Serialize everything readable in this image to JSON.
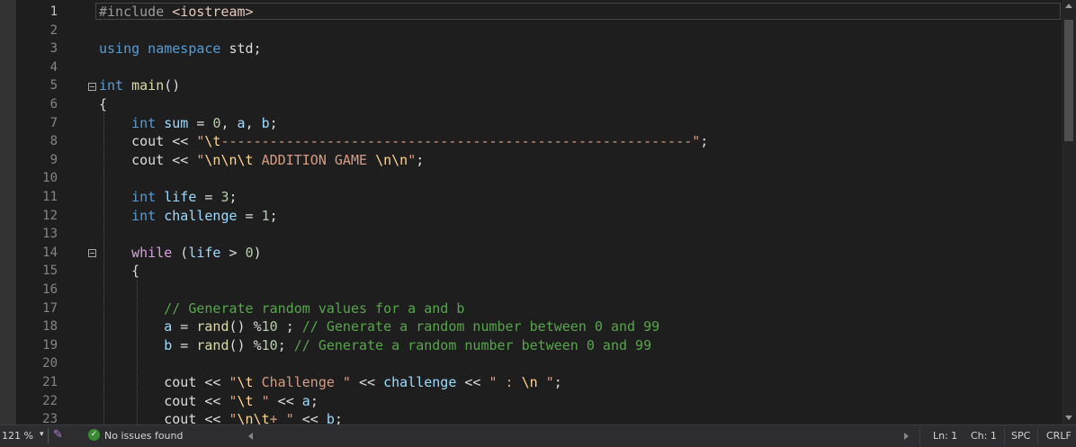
{
  "editor": {
    "lines": [
      {
        "n": "1",
        "tokens": [
          {
            "c": "pre",
            "t": "#include "
          },
          {
            "c": "inc",
            "t": "<iostream>"
          }
        ]
      },
      {
        "n": "2",
        "tokens": []
      },
      {
        "n": "3",
        "tokens": [
          {
            "c": "kw",
            "t": "using namespace "
          },
          {
            "c": "txt",
            "t": "std;"
          }
        ]
      },
      {
        "n": "4",
        "tokens": []
      },
      {
        "n": "5",
        "tokens": [
          {
            "c": "kw",
            "t": "int "
          },
          {
            "c": "fn",
            "t": "main"
          },
          {
            "c": "txt",
            "t": "()"
          }
        ]
      },
      {
        "n": "6",
        "tokens": [
          {
            "c": "txt",
            "t": "{"
          }
        ]
      },
      {
        "n": "7",
        "tokens": [
          {
            "c": "txt",
            "t": "    "
          },
          {
            "c": "kw",
            "t": "int "
          },
          {
            "c": "var",
            "t": "sum"
          },
          {
            "c": "txt",
            "t": " = "
          },
          {
            "c": "num",
            "t": "0"
          },
          {
            "c": "txt",
            "t": ", "
          },
          {
            "c": "var",
            "t": "a"
          },
          {
            "c": "txt",
            "t": ", "
          },
          {
            "c": "var",
            "t": "b"
          },
          {
            "c": "txt",
            "t": ";"
          }
        ]
      },
      {
        "n": "8",
        "tokens": [
          {
            "c": "txt",
            "t": "    cout << "
          },
          {
            "c": "str",
            "t": "\""
          },
          {
            "c": "esc",
            "t": "\\t"
          },
          {
            "c": "str",
            "t": "----------------------------------------------------------\""
          },
          {
            "c": "txt",
            "t": ";"
          }
        ]
      },
      {
        "n": "9",
        "tokens": [
          {
            "c": "txt",
            "t": "    cout << "
          },
          {
            "c": "str",
            "t": "\""
          },
          {
            "c": "esc",
            "t": "\\n\\n\\t"
          },
          {
            "c": "str",
            "t": " ADDITION GAME "
          },
          {
            "c": "esc",
            "t": "\\n\\n"
          },
          {
            "c": "str",
            "t": "\""
          },
          {
            "c": "txt",
            "t": ";"
          }
        ]
      },
      {
        "n": "10",
        "tokens": []
      },
      {
        "n": "11",
        "tokens": [
          {
            "c": "txt",
            "t": "    "
          },
          {
            "c": "kw",
            "t": "int "
          },
          {
            "c": "var",
            "t": "life"
          },
          {
            "c": "txt",
            "t": " = "
          },
          {
            "c": "num",
            "t": "3"
          },
          {
            "c": "txt",
            "t": ";"
          }
        ]
      },
      {
        "n": "12",
        "tokens": [
          {
            "c": "txt",
            "t": "    "
          },
          {
            "c": "kw",
            "t": "int "
          },
          {
            "c": "var",
            "t": "challenge"
          },
          {
            "c": "txt",
            "t": " = "
          },
          {
            "c": "num",
            "t": "1"
          },
          {
            "c": "txt",
            "t": ";"
          }
        ]
      },
      {
        "n": "13",
        "tokens": []
      },
      {
        "n": "14",
        "tokens": [
          {
            "c": "txt",
            "t": "    "
          },
          {
            "c": "ctl",
            "t": "while"
          },
          {
            "c": "txt",
            "t": " ("
          },
          {
            "c": "var",
            "t": "life"
          },
          {
            "c": "txt",
            "t": " > "
          },
          {
            "c": "num",
            "t": "0"
          },
          {
            "c": "txt",
            "t": ")"
          }
        ]
      },
      {
        "n": "15",
        "tokens": [
          {
            "c": "txt",
            "t": "    {"
          }
        ]
      },
      {
        "n": "16",
        "tokens": []
      },
      {
        "n": "17",
        "tokens": [
          {
            "c": "txt",
            "t": "        "
          },
          {
            "c": "cmt",
            "t": "// Generate random values for a and b"
          }
        ]
      },
      {
        "n": "18",
        "tokens": [
          {
            "c": "txt",
            "t": "        "
          },
          {
            "c": "var",
            "t": "a"
          },
          {
            "c": "txt",
            "t": " = "
          },
          {
            "c": "fn",
            "t": "rand"
          },
          {
            "c": "txt",
            "t": "() %"
          },
          {
            "c": "num",
            "t": "10"
          },
          {
            "c": "txt",
            "t": " ; "
          },
          {
            "c": "cmt",
            "t": "// Generate a random number between 0 and 99"
          }
        ]
      },
      {
        "n": "19",
        "tokens": [
          {
            "c": "txt",
            "t": "        "
          },
          {
            "c": "var",
            "t": "b"
          },
          {
            "c": "txt",
            "t": " = "
          },
          {
            "c": "fn",
            "t": "rand"
          },
          {
            "c": "txt",
            "t": "() %"
          },
          {
            "c": "num",
            "t": "10"
          },
          {
            "c": "txt",
            "t": "; "
          },
          {
            "c": "cmt",
            "t": "// Generate a random number between 0 and 99"
          }
        ]
      },
      {
        "n": "20",
        "tokens": []
      },
      {
        "n": "21",
        "tokens": [
          {
            "c": "txt",
            "t": "        cout << "
          },
          {
            "c": "str",
            "t": "\""
          },
          {
            "c": "esc",
            "t": "\\t"
          },
          {
            "c": "str",
            "t": " Challenge \""
          },
          {
            "c": "txt",
            "t": " << "
          },
          {
            "c": "var",
            "t": "challenge"
          },
          {
            "c": "txt",
            "t": " << "
          },
          {
            "c": "str",
            "t": "\" : "
          },
          {
            "c": "esc",
            "t": "\\n"
          },
          {
            "c": "str",
            "t": " \""
          },
          {
            "c": "txt",
            "t": ";"
          }
        ]
      },
      {
        "n": "22",
        "tokens": [
          {
            "c": "txt",
            "t": "        cout << "
          },
          {
            "c": "str",
            "t": "\""
          },
          {
            "c": "esc",
            "t": "\\t"
          },
          {
            "c": "str",
            "t": " \""
          },
          {
            "c": "txt",
            "t": " << "
          },
          {
            "c": "var",
            "t": "a"
          },
          {
            "c": "txt",
            "t": ";"
          }
        ]
      },
      {
        "n": "23",
        "tokens": [
          {
            "c": "txt",
            "t": "        cout << "
          },
          {
            "c": "str",
            "t": "\""
          },
          {
            "c": "esc",
            "t": "\\n\\t"
          },
          {
            "c": "str",
            "t": "+ \""
          },
          {
            "c": "txt",
            "t": " << "
          },
          {
            "c": "var",
            "t": "b"
          },
          {
            "c": "txt",
            "t": ";"
          }
        ]
      }
    ],
    "active_line": "1"
  },
  "status_bar": {
    "zoom": "121 %",
    "zoom_caret": "▾",
    "brush_icon": "✎",
    "check_icon": "✓",
    "issues": "No issues found",
    "line": "Ln: 1",
    "char": "Ch: 1",
    "spaces": "SPC",
    "eol": "CRLF"
  },
  "colors": {
    "background": "#1e1e1e",
    "keyword": "#569cd6",
    "control": "#d8a0df",
    "variable": "#9cdcfe",
    "function": "#dcdcaa",
    "string": "#d69d85",
    "escape": "#ffd68f",
    "number": "#b5cea8",
    "comment": "#57a64a"
  }
}
